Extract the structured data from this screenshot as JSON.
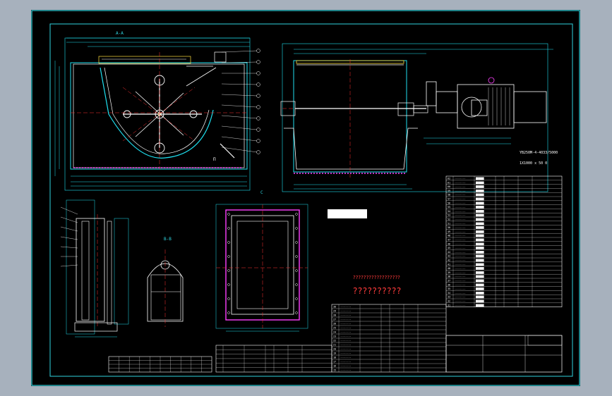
{
  "colors": {
    "page": "#a7b1bd",
    "canvas": "#000000",
    "frame": "#2fd4e0",
    "outline": "#1fe0f0",
    "centerline": "#ff3030",
    "part": "#ffffff",
    "hatch": "#ff40ff",
    "dim": "#1fe0f0",
    "yellow": "#ffe040",
    "green": "#3cff3c"
  },
  "watermark": {
    "caption": "??????????????????",
    "text": "??????????"
  },
  "motor_note": {
    "line1": "YB250M-4-4033/5000",
    "line2": "1X1000 x 50 0"
  },
  "views": {
    "section_a": "A-A",
    "section_b": "B-B",
    "view_c": "C",
    "mark_j": "Π"
  }
}
